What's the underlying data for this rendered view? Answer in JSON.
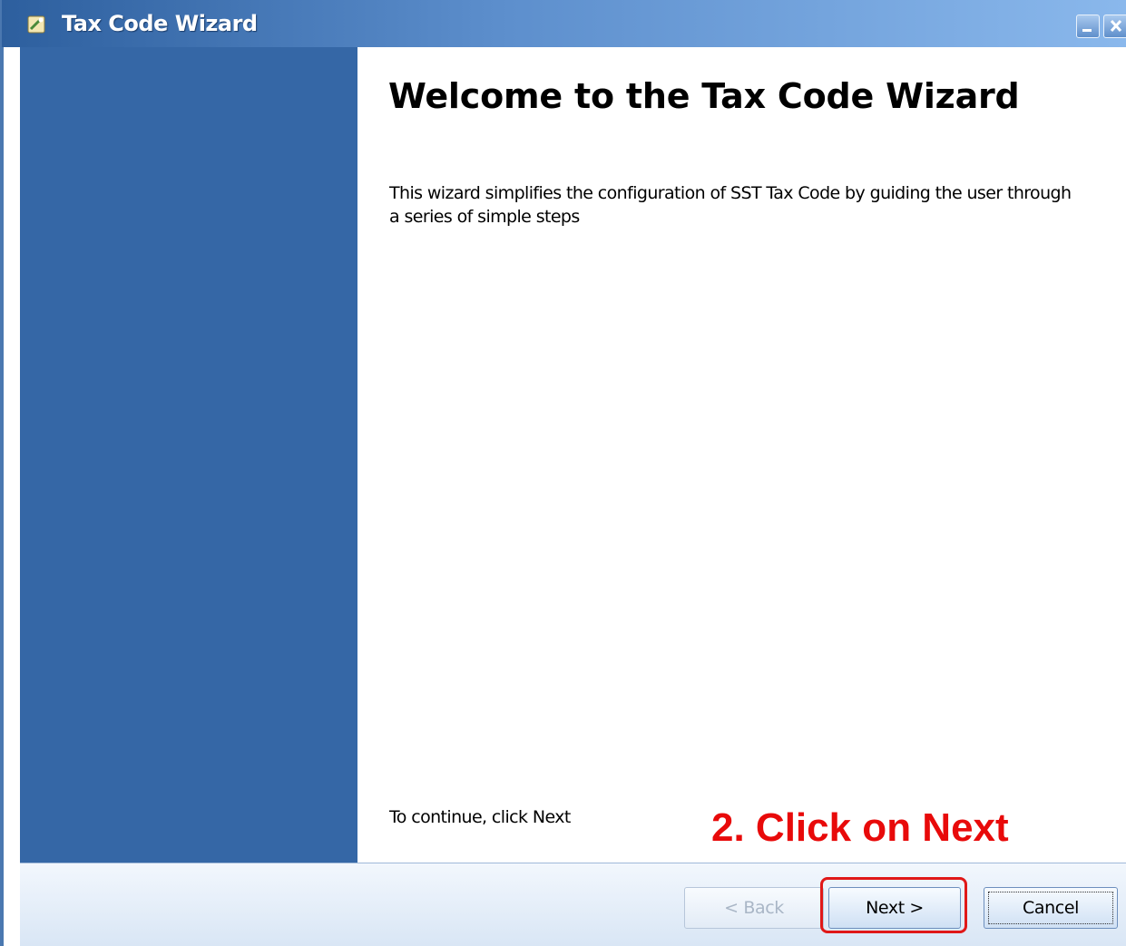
{
  "window": {
    "title": "Tax Code Wizard",
    "icon": "wizard-icon",
    "controls": {
      "minimize": "minimize-icon",
      "close": "close-icon"
    }
  },
  "main": {
    "heading": "Welcome to the Tax Code Wizard",
    "description": "This wizard simplifies the configuration of SST Tax Code by guiding the user through a series of simple steps",
    "continue_text": "To continue, click Next"
  },
  "annotation": {
    "text": "2. Click on Next",
    "color": "#e80a0a"
  },
  "footer": {
    "back_label": "< Back",
    "next_label": "Next >",
    "cancel_label": "Cancel"
  },
  "colors": {
    "side_panel": "#3567a6",
    "titlebar_start": "#2d5f9e",
    "titlebar_end": "#8ab8ec"
  }
}
